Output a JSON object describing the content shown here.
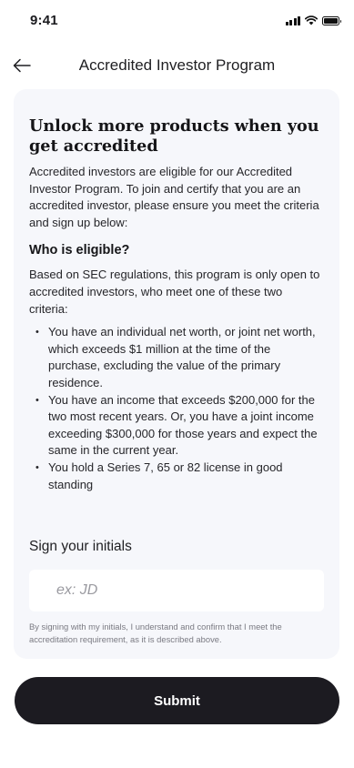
{
  "status_bar": {
    "time": "9:41"
  },
  "header": {
    "title": "Accredited Investor Program"
  },
  "card": {
    "headline": "Unlock more products when you get accredited",
    "intro": "Accredited investors are eligible for our Accredited Investor Program. To join and certify that you are an accredited investor, please ensure you meet the criteria and sign up below:",
    "eligibility_title": "Who is eligible?",
    "eligibility_intro": "Based on SEC regulations, this program is only open to accredited investors, who meet one of these two criteria:",
    "criteria": [
      "You have an individual net worth, or joint net worth, which exceeds $1 million at the time of the purchase, excluding the value of the primary residence.",
      "You have an income that exceeds $200,000 for the two most recent years. Or, you have a joint income exceeding $300,000 for those years and expect the same in the current year.",
      "You hold a Series 7, 65 or 82 license in good standing"
    ],
    "sign_label": "Sign your initials",
    "initials_placeholder": "ex: JD",
    "initials_value": "",
    "disclaimer": "By signing with my initials, I understand and confirm that I meet the accreditation requirement, as it is described above."
  },
  "submit_label": "Submit",
  "colors": {
    "card_background": "#f6f7fb",
    "button_background": "#1c1b21",
    "button_text": "#ffffff"
  }
}
